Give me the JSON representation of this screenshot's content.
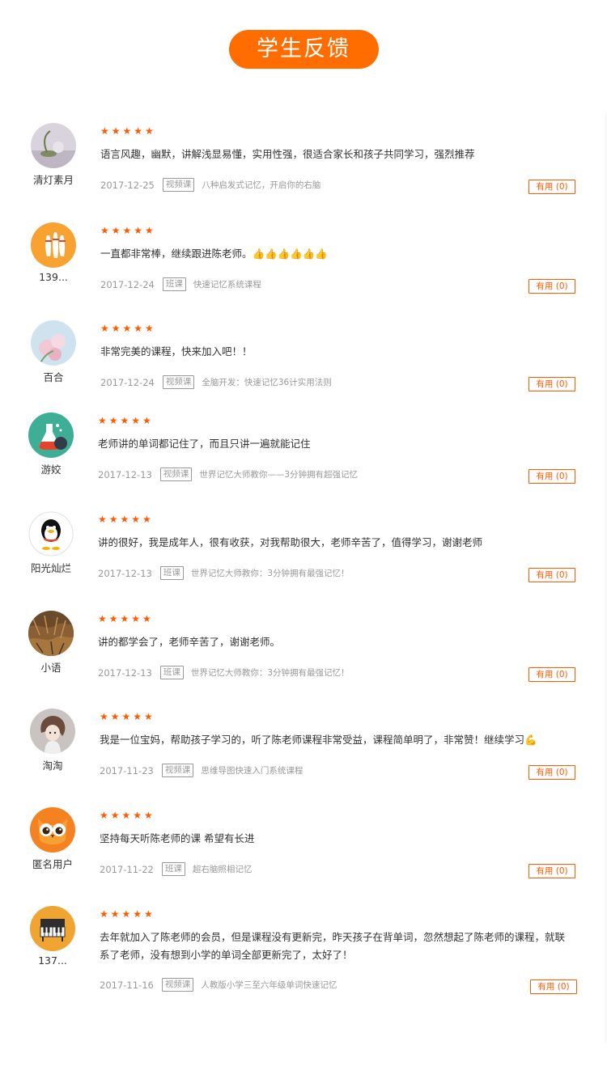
{
  "header": {
    "title": "学生反馈"
  },
  "reviews": [
    {
      "name": "清灯素月",
      "stars": "★★★★★",
      "text": "语言风趣，幽默，讲解浅显易懂，实用性强，很适合家长和孩子共同学习，强烈推荐",
      "date": "2017-12-25",
      "tag": "视频课",
      "course": "八种启发式记忆，开启你的右脑",
      "useful": "有用 (0)"
    },
    {
      "name": "139...",
      "stars": "★★★★★",
      "text": "一直都非常棒，继续跟进陈老师。👍👍👍👍👍👍",
      "date": "2017-12-24",
      "tag": "班课",
      "course": "快速记忆系统课程",
      "useful": "有用 (0)"
    },
    {
      "name": "百合",
      "stars": "★★★★★",
      "text": "非常完美的课程，快来加入吧！！",
      "date": "2017-12-24",
      "tag": "视频课",
      "course": "全脑开发：快速记忆36计实用法则",
      "useful": "有用 (0)"
    },
    {
      "name": "游姣",
      "stars": "★★★★★",
      "text": "老师讲的单词都记住了，而且只讲一遍就能记住",
      "date": "2017-12-13",
      "tag": "视频课",
      "course": "世界记忆大师教你——3分钟拥有超强记忆",
      "useful": "有用 (0)"
    },
    {
      "name": "阳光灿烂",
      "stars": "★★★★★",
      "text": "讲的很好，我是成年人，很有收获，对我帮助很大，老师辛苦了，值得学习，谢谢老师",
      "date": "2017-12-13",
      "tag": "班课",
      "course": "世界记忆大师教你：3分钟拥有最强记忆！",
      "useful": "有用 (0)"
    },
    {
      "name": "小语",
      "stars": "★★★★★",
      "text": "讲的都学会了，老师辛苦了，谢谢老师。",
      "date": "2017-12-13",
      "tag": "班课",
      "course": "世界记忆大师教你：3分钟拥有最强记忆！",
      "useful": "有用 (0)"
    },
    {
      "name": "淘淘",
      "stars": "★★★★★",
      "text": "我是一位宝妈，帮助孩子学习的，听了陈老师课程非常受益，课程简单明了，非常赞！继续学习💪",
      "date": "2017-11-23",
      "tag": "视频课",
      "course": "思维导图快速入门系统课程",
      "useful": "有用 (0)"
    },
    {
      "name": "匿名用户",
      "stars": "★★★★★",
      "text": "坚持每天听陈老师的课 希望有长进",
      "date": "2017-11-22",
      "tag": "班课",
      "course": "超右脑照相记忆",
      "useful": "有用 (0)"
    },
    {
      "name": "137...",
      "stars": "★★★★★",
      "text": "去年就加入了陈老师的会员，但是课程没有更新完，昨天孩子在背单词，忽然想起了陈老师的课程，就联系了老师，没有想到小学的单词全部更新完了，太好了！",
      "date": "2017-11-16",
      "tag": "视频课",
      "course": "人教版小学三至六年级单词快速记忆",
      "useful": "有用 (0)"
    }
  ],
  "avatar_icons": [
    "still-life-photo-icon",
    "bowling-icon",
    "flower-photo-icon",
    "chemistry-flask-icon",
    "penguin-icon",
    "nature-photo-icon",
    "cartoon-girl-icon",
    "owl-icon",
    "piano-icon"
  ],
  "colors": {
    "accent": "#ff6d00",
    "star": "#ff5a00",
    "text": "#333333",
    "muted": "#999999"
  }
}
